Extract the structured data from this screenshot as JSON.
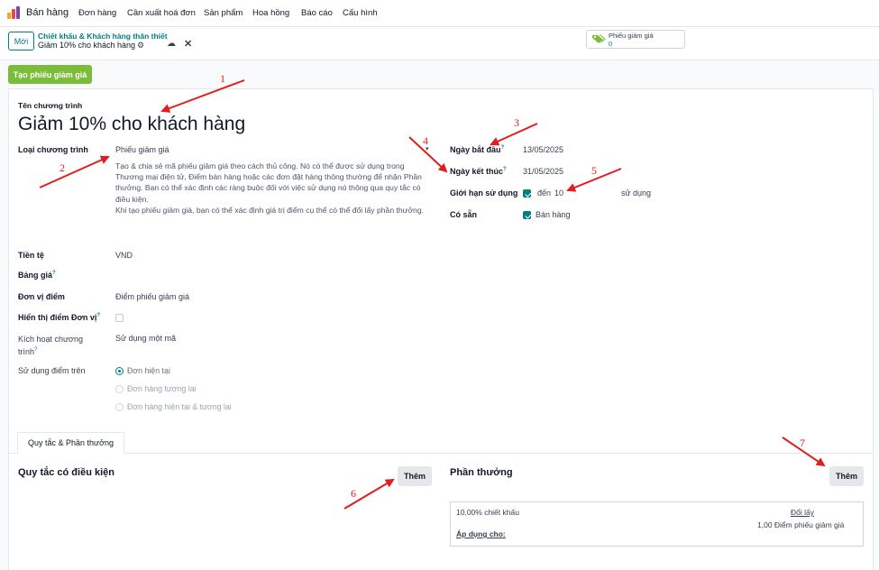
{
  "app": {
    "title": "Bán hàng"
  },
  "nav": [
    "Đơn hàng",
    "Cần xuất hoá đơn",
    "Sản phẩm",
    "Hoa hồng",
    "Báo cáo",
    "Cấu hình"
  ],
  "control": {
    "new_label": "Mới",
    "breadcrumb_parent": "Chiết khấu & Khách hàng thân thiết",
    "breadcrumb_current": "Giảm 10% cho khách hàng",
    "smart_button": {
      "label": "Phiếu giảm giá",
      "count": "0"
    }
  },
  "actions": {
    "create_coupon": "Tạo phiếu giảm giá"
  },
  "form": {
    "program_name_label": "Tên chương trình",
    "program_name": "Giảm 10% cho khách hàng",
    "program_type_label": "Loại chương trình",
    "program_type": "Phiếu giảm giá",
    "program_type_desc": "Tạo & chia sẻ mã phiếu giảm giá theo cách thủ công. Nó có thể được sử dụng trong Thương mại điện tử, Điểm bán hàng hoặc các đơn đặt hàng thông thường để nhận Phần thưởng. Bạn có thể xác định các ràng buộc đối với việc sử dụng nó thông qua quy tắc có điều kiện.",
    "program_type_desc2": "Khi tạo phiếu giảm giá, bạn có thể xác định giá trị điểm cụ thể có thể đổi lấy phần thưởng.",
    "currency_label": "Tiền tệ",
    "currency": "VND",
    "pricelist_label": "Bảng giá",
    "point_unit_label": "Đơn vị điểm",
    "point_unit": "Điểm phiếu giảm giá",
    "show_point_unit_label": "Hiển thị điểm Đơn vị",
    "trigger_label_1": "Kích hoạt chương",
    "trigger_label_2": "trình",
    "trigger": "Sử dụng một mã",
    "apply_points_label": "Sử dụng điểm trên",
    "apply_points_options": [
      "Đơn hiện tại",
      "Đơn hàng tương lai",
      "Đơn hàng hiện tại & tương lai"
    ],
    "start_date_label": "Ngày bắt đầu",
    "start_date": "13/05/2025",
    "end_date_label": "Ngày kết thúc",
    "end_date": "31/05/2025",
    "limit_label": "Giới hạn sử dụng",
    "limit_prefix": "đến",
    "limit_value": "10",
    "limit_suffix": "sử dụng",
    "available_label": "Có sẵn",
    "available_option": "Bán hàng"
  },
  "tabs": {
    "rules_rewards": "Quy tắc & Phần thưởng"
  },
  "rules": {
    "title": "Quy tắc có điều kiện",
    "add_label": "Thêm"
  },
  "rewards": {
    "title": "Phần thưởng",
    "add_label": "Thêm",
    "item_desc": "10,00% chiết khấu",
    "redeem_label": "Đổi lấy",
    "redeem_points": "1,00 Điểm phiếu giảm giá",
    "apply_on_label": "Áp dụng cho:"
  },
  "annotations": [
    "1",
    "2",
    "3",
    "4",
    "5",
    "6",
    "7"
  ],
  "colors": {
    "primary": "#017e84",
    "create_button": "#7bbc3a",
    "annotation": "#e11d1d"
  }
}
